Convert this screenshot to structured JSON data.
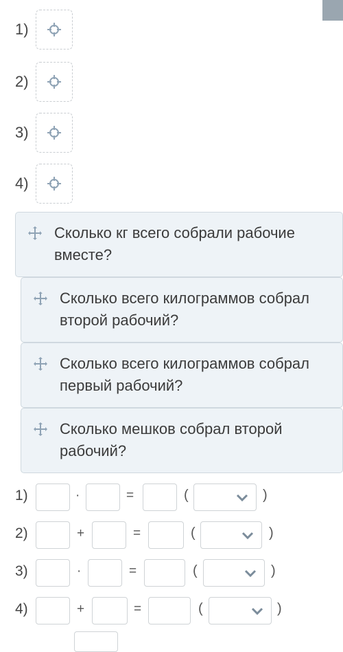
{
  "slots": [
    {
      "label": "1)"
    },
    {
      "label": "2)"
    },
    {
      "label": "3)"
    },
    {
      "label": "4)"
    }
  ],
  "cards": [
    {
      "text": "Сколько кг всего собрали рабочие вместе?"
    },
    {
      "text": "Сколько всего килограммов собрал второй рабочий?"
    },
    {
      "text": "Сколько всего килограммов собрал первый рабочий?"
    },
    {
      "text": "Сколько мешков собрал второй рабочий?"
    }
  ],
  "equations": [
    {
      "label": "1)",
      "op": "·",
      "eq": "=",
      "open": "(",
      "close": ")",
      "unit_selected": ""
    },
    {
      "label": "2)",
      "op": "+",
      "eq": "=",
      "open": "(",
      "close": ")",
      "unit_selected": ""
    },
    {
      "label": "3)",
      "op": "·",
      "eq": "=",
      "open": "(",
      "close": ")",
      "unit_selected": ""
    },
    {
      "label": "4)",
      "op": "+",
      "eq": "=",
      "open": "(",
      "close": ")",
      "unit_selected": ""
    }
  ],
  "colors": {
    "accent_icon": "#8fa3b5",
    "chevron": "#7b8c9b",
    "card_bg": "#eef3f7"
  },
  "icons": {
    "slot": "crosshair-icon",
    "card": "move-icon",
    "select": "chevron-down-icon"
  }
}
